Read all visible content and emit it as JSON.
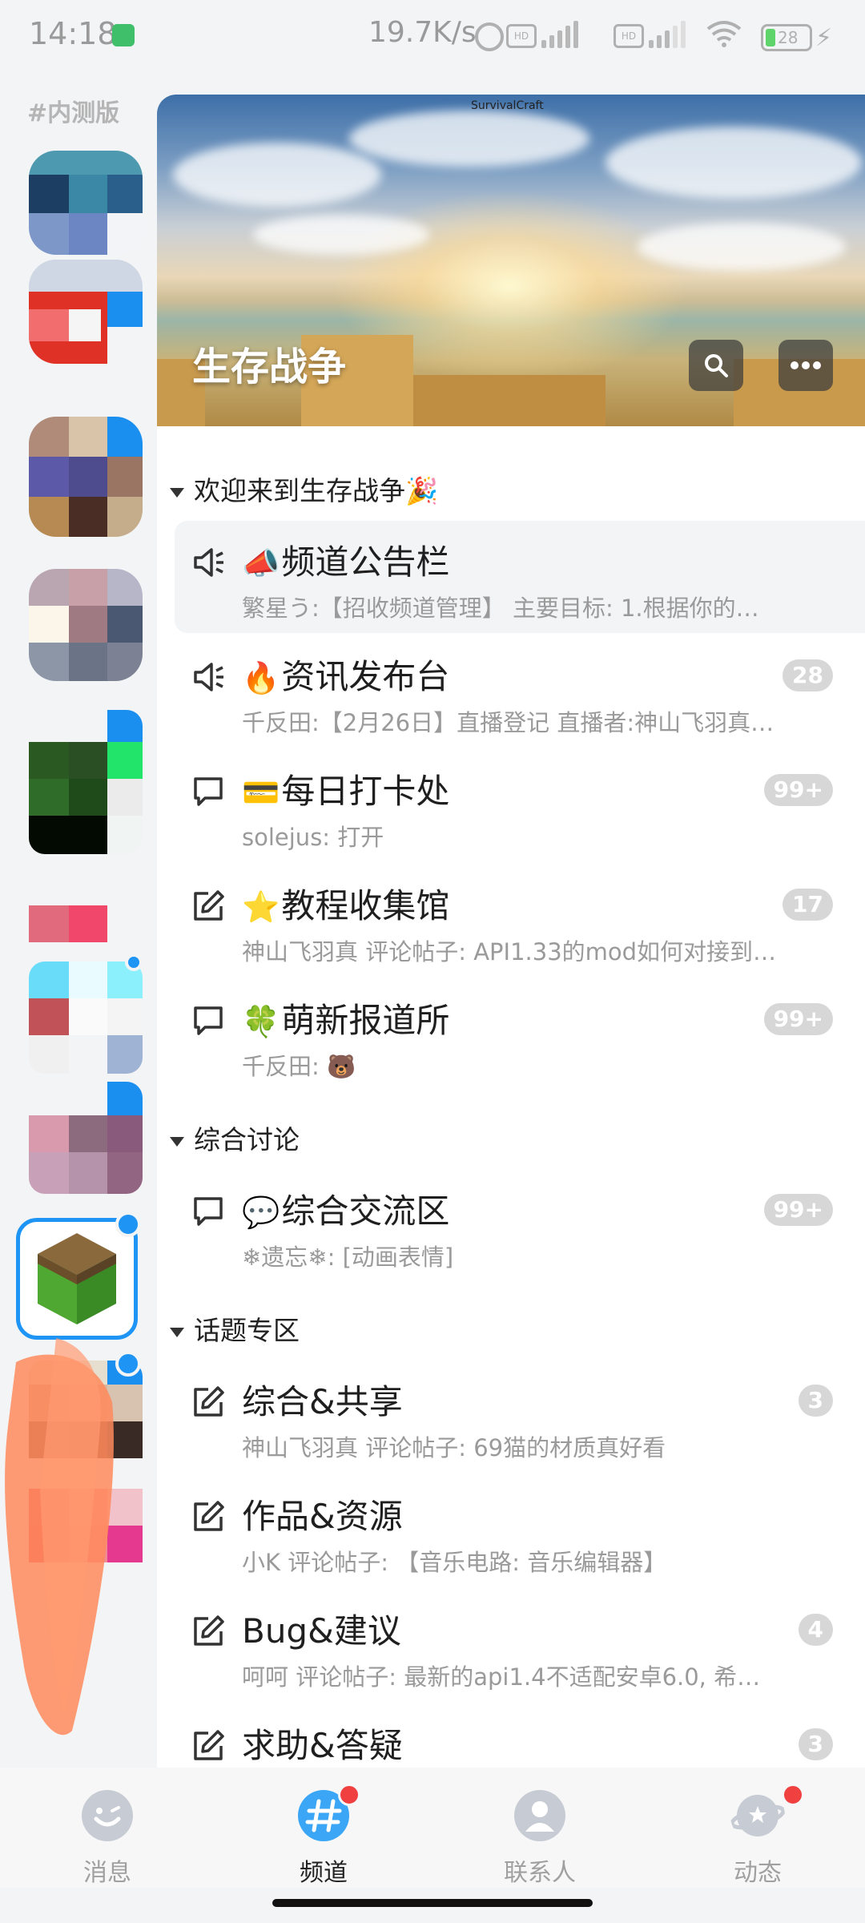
{
  "status_bar": {
    "time": "14:18",
    "net_speed": "19.7K/s",
    "hd1": "HD",
    "hd2": "HD",
    "battery": "28"
  },
  "sidebar": {
    "label": "#内测版"
  },
  "banner": {
    "title": "生存战争",
    "tag": "SurvivalCraft",
    "search_icon": "search-icon",
    "more_icon": "more-icon"
  },
  "categories": [
    {
      "title": "欢迎来到生存战争🎉",
      "channels": [
        {
          "icon": "announcement-icon",
          "emoji": "📣",
          "name": "频道公告栏",
          "sub": "繁星う:【招收频道管理】 主要目标: 1.根据你的…",
          "badge": ""
        },
        {
          "icon": "announcement-icon",
          "emoji": "🔥",
          "name": "资讯发布台",
          "sub": "千反田:【2月26日】直播登记 直播者:神山飞羽真…",
          "badge": "28"
        },
        {
          "icon": "chat-icon",
          "emoji": "💳",
          "name": "每日打卡处",
          "sub": "solejus: 打开",
          "badge": "99+"
        },
        {
          "icon": "post-icon",
          "emoji": "⭐",
          "name": "教程收集馆",
          "sub": "神山飞羽真 评论帖子: API1.33的mod如何对接到…",
          "badge": "17"
        },
        {
          "icon": "chat-icon",
          "emoji": "🍀",
          "name": "萌新报道所",
          "sub": "千反田: 🐻",
          "badge": "99+"
        }
      ]
    },
    {
      "title": "综合讨论",
      "channels": [
        {
          "icon": "chat-icon",
          "emoji": "💬",
          "name": "综合交流区",
          "sub": "❄遗忘❄: [动画表情]",
          "badge": "99+"
        }
      ]
    },
    {
      "title": "话题专区",
      "channels": [
        {
          "icon": "post-icon",
          "emoji": "",
          "name": "综合&共享",
          "sub": "神山飞羽真 评论帖子: 69猫的材质真好看",
          "badge": "3"
        },
        {
          "icon": "post-icon",
          "emoji": "",
          "name": "作品&资源",
          "sub": "小K 评论帖子: 【音乐电路: 音乐编辑器】",
          "badge": ""
        },
        {
          "icon": "post-icon",
          "emoji": "",
          "name": "Bug&建议",
          "sub": "呵呵 评论帖子: 最新的api1.4不适配安卓6.0, 希…",
          "badge": "4"
        },
        {
          "icon": "post-icon",
          "emoji": "",
          "name": "求助&答疑",
          "sub": "",
          "badge": "3"
        }
      ]
    }
  ],
  "bottom_nav": [
    {
      "label": "消息",
      "icon": "message-icon"
    },
    {
      "label": "频道",
      "icon": "channel-icon"
    },
    {
      "label": "联系人",
      "icon": "contacts-icon"
    },
    {
      "label": "动态",
      "icon": "planet-icon"
    }
  ],
  "colors": {
    "accent": "#1e94f5",
    "notify": "#f04040",
    "badge": "#d7d7d7"
  }
}
